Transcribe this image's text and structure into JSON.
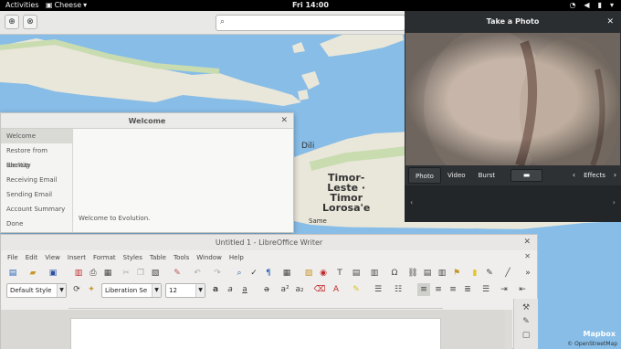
{
  "topbar": {
    "activities": "Activities",
    "app_menu": "Cheese",
    "clock": "Fri 14:00",
    "tray_icons": [
      "wifi-icon",
      "volume-icon",
      "battery-icon",
      "power-menu-icon"
    ]
  },
  "map": {
    "labels": {
      "dili": "Dili",
      "timor_leste": "Timor-\nLeste ·\nTimor\nLorosa'e",
      "same": "Same"
    },
    "mapbox": "Mapbox",
    "osm_credit": "© OpenStreetMap"
  },
  "welcome": {
    "title": "Welcome",
    "nav": [
      "Welcome",
      "Restore from Backup",
      "Identity",
      "Receiving Email",
      "Sending Email",
      "Account Summary",
      "Done"
    ],
    "active_index": 0,
    "message": "Welcome to Evolution."
  },
  "photo": {
    "title": "Take a Photo",
    "modes": [
      "Photo",
      "Video",
      "Burst"
    ],
    "active_mode": "Photo",
    "effects": "Effects"
  },
  "writer": {
    "title": "Untitled 1 - LibreOffice Writer",
    "menus": [
      "File",
      "Edit",
      "View",
      "Insert",
      "Format",
      "Styles",
      "Table",
      "Tools",
      "Window",
      "Help"
    ],
    "paragraph_style": "Default Style",
    "font_name": "Liberation Se",
    "font_size": "12"
  }
}
